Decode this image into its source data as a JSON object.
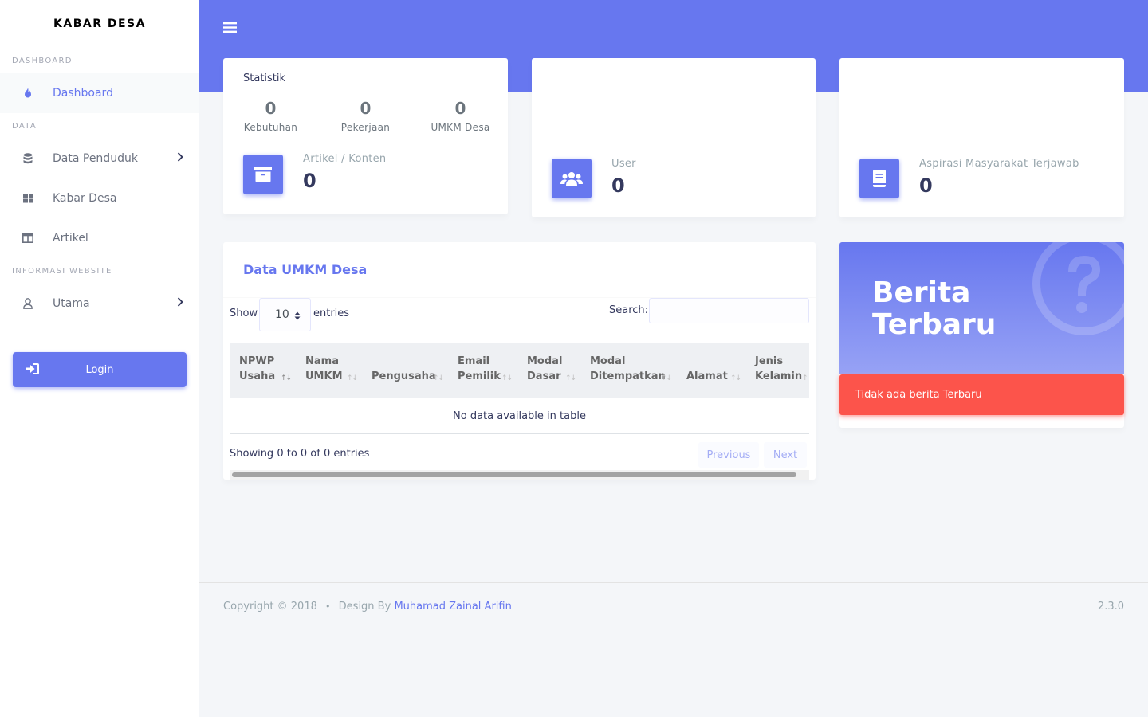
{
  "brand": "KABAR DESA",
  "sidebar": {
    "sections": [
      {
        "header": "DASHBOARD"
      },
      {
        "header": "DATA"
      },
      {
        "header": "INFORMASI WEBSITE"
      }
    ],
    "items": [
      {
        "label": "Dashboard",
        "icon": "fire-icon"
      },
      {
        "label": "Data Penduduk",
        "icon": "database-icon"
      },
      {
        "label": "Kabar Desa",
        "icon": "grid-icon"
      },
      {
        "label": "Artikel",
        "icon": "columns-icon"
      },
      {
        "label": "Utama",
        "icon": "user-icon"
      }
    ],
    "login_label": "Login"
  },
  "statistik": {
    "title": "Statistik",
    "items": [
      {
        "value": "0",
        "label": "Kebutuhan"
      },
      {
        "value": "0",
        "label": "Pekerjaan"
      },
      {
        "value": "0",
        "label": "UMKM Desa"
      }
    ],
    "artikel_label": "Artikel / Konten",
    "artikel_value": "0"
  },
  "user_card": {
    "label": "User",
    "value": "0"
  },
  "aspirasi_card": {
    "label": "Aspirasi Masyarakat Terjawab",
    "value": "0"
  },
  "table": {
    "title": "Data UMKM Desa",
    "show_label": "Show",
    "page_size": "10",
    "entries_label": "entries",
    "search_label": "Search:",
    "search_value": "",
    "columns": [
      [
        "NPWP",
        "Usaha"
      ],
      [
        "Nama",
        "UMKM"
      ],
      [
        "",
        "Pengusaha"
      ],
      [
        "Email",
        "Pemilik"
      ],
      [
        "Modal",
        "Dasar"
      ],
      [
        "Modal",
        "Ditempatkan"
      ],
      [
        "",
        "Alamat"
      ],
      [
        "Jenis",
        "Kelamin"
      ]
    ],
    "empty_text": "No data available in table",
    "info": "Showing 0 to 0 of 0 entries",
    "prev": "Previous",
    "next": "Next"
  },
  "news": {
    "title_line1": "Berita",
    "title_line2": "Terbaru",
    "alert": "Tidak ada berita Terbaru"
  },
  "footer": {
    "copyright": "Copyright © 2018",
    "separator": "•",
    "design_by": "Design By",
    "author": "Muhamad Zainal Arifin",
    "version": "2.3.0"
  },
  "colors": {
    "primary": "#6777ef",
    "danger": "#fc544b",
    "background": "#f4f6f9"
  }
}
